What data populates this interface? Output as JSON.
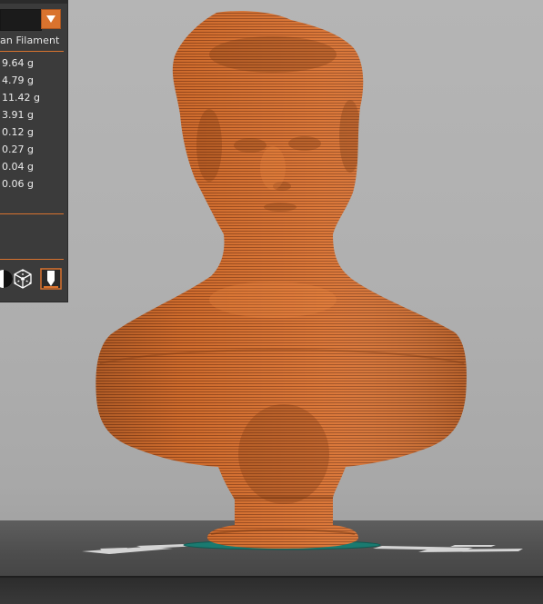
{
  "panel": {
    "header_label": "an Filament",
    "dropdown_icon": "triangle-down-icon",
    "weights": [
      "9.64 g",
      "4.79 g",
      "11.42 g",
      "3.91 g",
      "0.12 g",
      "0.27 g",
      "0.04 g",
      "0.06 g"
    ],
    "view_buttons": [
      "contrast-icon",
      "cube-wireframe-icon",
      "nozzle-icon"
    ]
  },
  "scene": {
    "model_color": "#d9712f",
    "layer_line_color": "#8a4018",
    "accent_color": "#d9732e",
    "bed_marker_color": "#1a7a70"
  }
}
